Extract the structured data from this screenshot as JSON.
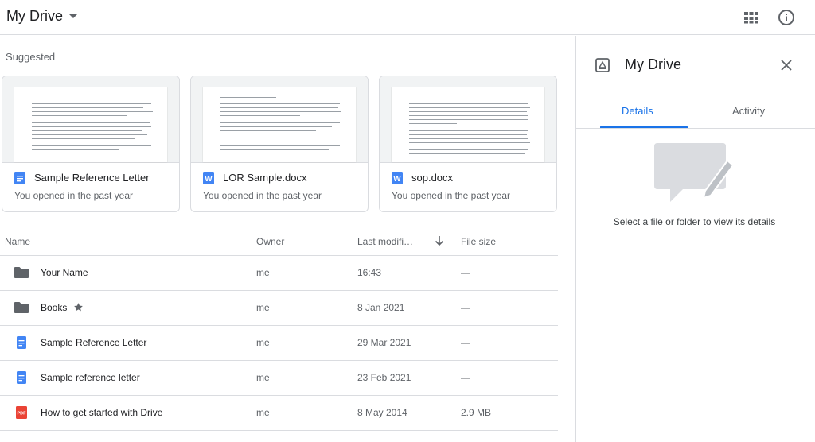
{
  "header": {
    "title": "My Drive",
    "grid_icon": "grid-view-icon",
    "info_icon": "info-icon"
  },
  "suggested": {
    "label": "Suggested",
    "cards": [
      {
        "name": "Sample Reference Letter",
        "subtitle": "You opened in the past year",
        "icon": "google-docs-icon"
      },
      {
        "name": "LOR Sample.docx",
        "subtitle": "You opened in the past year",
        "icon": "word-doc-icon"
      },
      {
        "name": "sop.docx",
        "subtitle": "You opened in the past year",
        "icon": "word-doc-icon"
      }
    ]
  },
  "table": {
    "columns": {
      "name": "Name",
      "owner": "Owner",
      "modified": "Last modifi…",
      "size": "File size"
    },
    "rows": [
      {
        "name": "Your Name",
        "owner": "me",
        "modified": "16:43",
        "size": "—",
        "icon": "folder-icon",
        "starred": false
      },
      {
        "name": "Books",
        "owner": "me",
        "modified": "8 Jan 2021",
        "size": "—",
        "icon": "folder-icon",
        "starred": true
      },
      {
        "name": "Sample Reference Letter",
        "owner": "me",
        "modified": "29 Mar 2021",
        "size": "—",
        "icon": "google-docs-icon",
        "starred": false
      },
      {
        "name": "Sample reference letter",
        "owner": "me",
        "modified": "23 Feb 2021",
        "size": "—",
        "icon": "google-docs-icon",
        "starred": false
      },
      {
        "name": "How to get started with Drive",
        "owner": "me",
        "modified": "8 May 2014",
        "size": "2.9 MB",
        "icon": "pdf-icon",
        "starred": false
      }
    ]
  },
  "details_panel": {
    "title": "My Drive",
    "tabs": [
      "Details",
      "Activity"
    ],
    "active_tab": "Details",
    "empty_message": "Select a file or folder to view its details"
  },
  "colors": {
    "accent": "#1a73e8",
    "docs_blue": "#4285f4",
    "pdf_red": "#ea4335",
    "folder": "#5f6368"
  }
}
